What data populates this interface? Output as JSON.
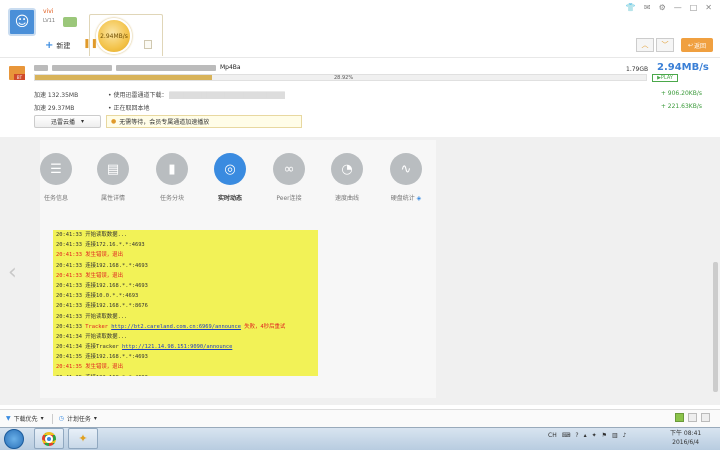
{
  "header": {
    "username": "vivi",
    "user_level": "LV11",
    "speed_circle": "2.94MB/s",
    "new_label": "新建",
    "back_label": "返回"
  },
  "download": {
    "file_name": "Mp4Ba",
    "file_size": "1.79GB",
    "speed": "2.94MB/s",
    "progress_pct": "28.92%",
    "progress_value": 28.92,
    "play_label": "PLAY",
    "accel_label_1": "加速 132.35MB",
    "accel_label_2": "加速 29.37MB",
    "mode_1": "使用迅雷通道下载：",
    "mode_2": "正在取回本地",
    "speed_1": "+ 906.20KB/s",
    "speed_2": "+ 221.63KB/s",
    "cloud_btn": "迅雷云播",
    "hint": "无需等待，会员专属通道加速播放"
  },
  "tabs": [
    {
      "label": "任务信息",
      "icon": "info-icon"
    },
    {
      "label": "属性详情",
      "icon": "detail-icon"
    },
    {
      "label": "任务分块",
      "icon": "chart-icon"
    },
    {
      "label": "实时动态",
      "icon": "compass-icon"
    },
    {
      "label": "Peer连接",
      "icon": "link-icon"
    },
    {
      "label": "速度曲线",
      "icon": "gauge-icon"
    },
    {
      "label": "硬盘统计",
      "icon": "wave-icon"
    }
  ],
  "log": [
    {
      "time": "20:41:33",
      "text": "开始读取数据...",
      "style": "normal"
    },
    {
      "time": "20:41:33",
      "text": "连接172.16.*.*:4693",
      "style": "normal"
    },
    {
      "time": "20:41:33",
      "text": "发生错误，退出",
      "style": "red"
    },
    {
      "time": "20:41:33",
      "text": "连接192.168.*.*:4693",
      "style": "normal"
    },
    {
      "time": "20:41:33",
      "text": "发生错误，退出",
      "style": "red"
    },
    {
      "time": "20:41:33",
      "text": "连接192.168.*.*:4693",
      "style": "normal"
    },
    {
      "time": "20:41:33",
      "text": "连接10.0.*.*:4693",
      "style": "normal"
    },
    {
      "time": "20:41:33",
      "text": "连接192.168.*.*:8676",
      "style": "normal"
    },
    {
      "time": "20:41:33",
      "text": "开始读取数据...",
      "style": "normal"
    },
    {
      "time": "20:41:33",
      "text": "Tracker ",
      "link": "http://bt2.careland.com.cn:6969/announce",
      "suffix": " 失败，4秒后重试",
      "style": "tracker-fail"
    },
    {
      "time": "20:41:34",
      "text": "开始读取数据...",
      "style": "normal"
    },
    {
      "time": "20:41:34",
      "text": "连接Tracker ",
      "link": "http://121.14.98.151:9090/announce",
      "suffix": "",
      "style": "tracker"
    },
    {
      "time": "20:41:35",
      "text": "连接192.168.*.*:4693",
      "style": "normal"
    },
    {
      "time": "20:41:35",
      "text": "发生错误，退出",
      "style": "red"
    },
    {
      "time": "20:41:35",
      "text": "连接192.168.*.*:4693",
      "style": "normal"
    }
  ],
  "bottom": {
    "download_priority": "下载优先",
    "scheduled_task": "计划任务"
  },
  "taskbar": {
    "ime": "CH",
    "time_label": "下午 08:41",
    "date": "2016/6/4"
  }
}
